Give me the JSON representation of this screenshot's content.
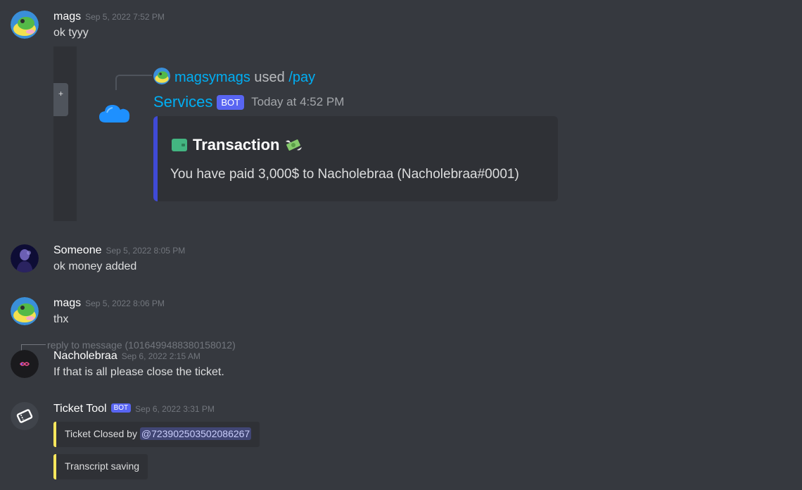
{
  "messages": [
    {
      "user": "mags",
      "timestamp": "Sep 5, 2022 7:52 PM",
      "text": "ok tyyy"
    },
    {
      "user": "Someone",
      "timestamp": "Sep 5, 2022 8:05 PM",
      "text": "ok money added"
    },
    {
      "user": "mags",
      "timestamp": "Sep 5, 2022 8:06 PM",
      "text": "thx"
    },
    {
      "user": "Nacholebraa",
      "timestamp": "Sep 6, 2022 2:15 AM",
      "text": "If that is all please close the ticket.",
      "reply_ref": "reply to message (1016499488380158012)"
    },
    {
      "user": "Ticket Tool",
      "bot_tag": "BOT",
      "timestamp": "Sep 6, 2022 3:31 PM",
      "embed1_prefix": "Ticket Closed by",
      "embed1_mention": "@723902503502086267",
      "embed2_text": "Transcript saving"
    }
  ],
  "screenshot_embed": {
    "expand_glyph": "+",
    "reply_user": "magsymags",
    "reply_used": "used",
    "reply_command": "/pay",
    "bot_name": "Services",
    "bot_tag": "BOT",
    "bot_time": "Today at 4:52 PM",
    "embed_title": "Transaction",
    "embed_description": "You have paid 3,000$ to Nacholebraa (Nacholebraa#0001)",
    "accent_color": "#3f4ad6"
  },
  "colors": {
    "background": "#36393f",
    "embed_bg": "#2f3136",
    "ticket_embed_accent": "#fee75c",
    "link_blue": "#00aff4",
    "bot_badge": "#5865f2"
  }
}
